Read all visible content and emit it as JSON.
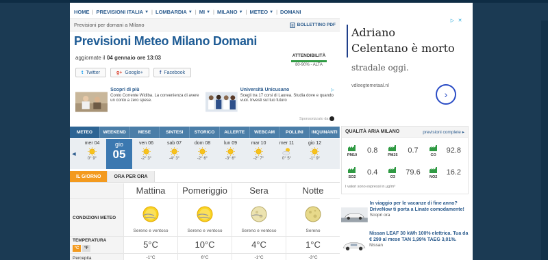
{
  "breadcrumb": [
    {
      "label": "HOME",
      "dropdown": false
    },
    {
      "label": "PREVISIONI ITALIA",
      "dropdown": true
    },
    {
      "label": "LOMBARDIA",
      "dropdown": true
    },
    {
      "label": "MI",
      "dropdown": true
    },
    {
      "label": "MILANO",
      "dropdown": true
    },
    {
      "label": "METEO",
      "dropdown": true
    },
    {
      "label": "DOMANI",
      "dropdown": false
    }
  ],
  "subheader": {
    "text": "Previsioni per domani a Milano",
    "bulletin": "BOLLETTINO PDF"
  },
  "title": "Previsioni Meteo Milano Domani",
  "updated": {
    "prefix": "aggiornate il",
    "date": "04 gennaio ore 13:03"
  },
  "reliability": {
    "label": "ATTENDIBILITÀ",
    "value": "80-90% - ALTA",
    "fraction": 0.85
  },
  "social": [
    {
      "icon": "twitter-icon",
      "glyph": "t",
      "label": "Twitter",
      "color": "#1da1f2"
    },
    {
      "icon": "google-plus-icon",
      "glyph": "g+",
      "label": "Google+",
      "color": "#dd4b39"
    },
    {
      "icon": "facebook-icon",
      "glyph": "f",
      "label": "Facebook",
      "color": "#3b5998"
    }
  ],
  "ads": [
    {
      "title": "Scopri di più",
      "text": "Conto Corrente Widiba. La convenienza di avere un conto a zero spese."
    },
    {
      "title": "Università Unicusano",
      "text": "Scegli tra 17 corsi di Laurea. Studia dove e quando vuoi. Investi sul tuo futuro"
    }
  ],
  "sponsored": "Sponsorizzato da",
  "tabs": [
    "METEO",
    "WEEKEND",
    "MESE",
    "SINTESI",
    "STORICO",
    "ALLERTE",
    "WEBCAM",
    "POLLINI",
    "INQUINANTI"
  ],
  "days": [
    {
      "name": "mer 04",
      "temps": "0° 9°",
      "icon": "sun"
    },
    {
      "name": "gio",
      "num": "05",
      "temps": "",
      "icon": "sel"
    },
    {
      "name": "ven 06",
      "temps": "-2° 3°",
      "icon": "sun"
    },
    {
      "name": "sab 07",
      "temps": "-4° 3°",
      "icon": "sun"
    },
    {
      "name": "dom 08",
      "temps": "-2° 6°",
      "icon": "sun"
    },
    {
      "name": "lun 09",
      "temps": "-3° 6°",
      "icon": "sun"
    },
    {
      "name": "mar 10",
      "temps": "-2° 7°",
      "icon": "sun"
    },
    {
      "name": "mer 11",
      "temps": "0° 5°",
      "icon": "cloud"
    },
    {
      "name": "gio 12",
      "temps": "-1° 9°",
      "icon": "sun"
    }
  ],
  "day_tabs": [
    "IL GIORNO",
    "ORA PER ORA"
  ],
  "periods": [
    "Mattina",
    "Pomeriggio",
    "Sera",
    "Notte"
  ],
  "conditions": {
    "label": "CONDIZIONI METEO",
    "items": [
      {
        "desc": "Sereno e ventoso",
        "icon": "sun"
      },
      {
        "desc": "Sereno e ventoso",
        "icon": "sun"
      },
      {
        "desc": "Sereno e ventoso",
        "icon": "moon"
      },
      {
        "desc": "Sereno",
        "icon": "moon2"
      }
    ]
  },
  "temperature": {
    "label": "TEMPERATURA",
    "units": [
      "°C",
      "°F"
    ],
    "values": [
      "5°C",
      "10°C",
      "4°C",
      "1°C"
    ]
  },
  "perceived": {
    "label": "Percepita",
    "values": [
      "-1°C",
      "6°C",
      "-1°C",
      "-3°C"
    ]
  },
  "right_ad": {
    "line1": "Adriano",
    "line2": "Celentano è morto",
    "line3": "stradale oggi.",
    "url": "vdleegtemetaal.nl"
  },
  "air": {
    "title": "QUALITÀ ARIA MILANO",
    "link": "previsioni complete",
    "items": [
      {
        "label": "PM10",
        "value": "0.8"
      },
      {
        "label": "PM25",
        "value": "0.7"
      },
      {
        "label": "CO",
        "value": "92.8"
      },
      {
        "label": "SO2",
        "value": "0.4"
      },
      {
        "label": "O3",
        "value": "79.6"
      },
      {
        "label": "NO2",
        "value": "16.2"
      }
    ],
    "footer": "I valori sono espressi in µg/m³"
  },
  "promos": [
    {
      "title": "In viaggio per le vacanze di fine anno? DriveNow ti porta a Linate comodamente!",
      "sponsor": "Scopri ora"
    },
    {
      "title": "Nissan LEAF 30 kWh 100% elettrica. Tua da € 299 al mese TAN 1,99% TAEG 3,01%.",
      "sponsor": "Nissan"
    }
  ]
}
